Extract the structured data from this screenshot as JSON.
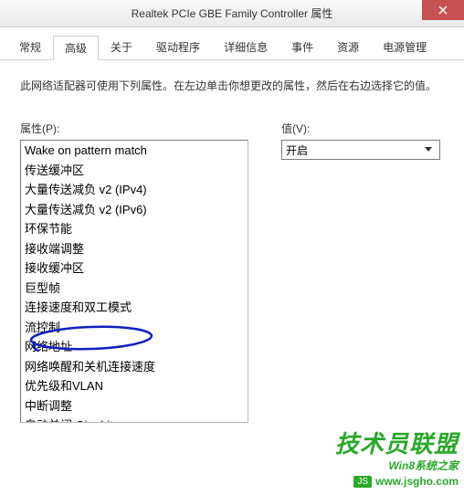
{
  "window": {
    "title": "Realtek PCIe GBE Family Controller 属性"
  },
  "tabs": {
    "items": [
      {
        "label": "常规"
      },
      {
        "label": "高级"
      },
      {
        "label": "关于"
      },
      {
        "label": "驱动程序"
      },
      {
        "label": "详细信息"
      },
      {
        "label": "事件"
      },
      {
        "label": "资源"
      },
      {
        "label": "电源管理"
      }
    ],
    "active_index": 1
  },
  "description": "此网络适配器可使用下列属性。在左边单击你想更改的属性，然后在右边选择它的值。",
  "property": {
    "label": "属性(P):",
    "items": [
      "Wake on pattern match",
      "传送缓冲区",
      "大量传送减负 v2 (IPv4)",
      "大量传送减负 v2 (IPv6)",
      "环保节能",
      "接收端调整",
      "接收缓冲区",
      "巨型帧",
      "连接速度和双工模式",
      "流控制",
      "网络地址",
      "网络唤醒和关机连接速度",
      "优先级和VLAN",
      "中断调整",
      "自动关闭 Gigabit"
    ]
  },
  "value": {
    "label": "值(V):",
    "selected": "开启"
  },
  "watermark": {
    "main": "技术员联盟",
    "sub": "Win8系统之家",
    "badge": "JS",
    "url": "www.jsgho.com"
  }
}
